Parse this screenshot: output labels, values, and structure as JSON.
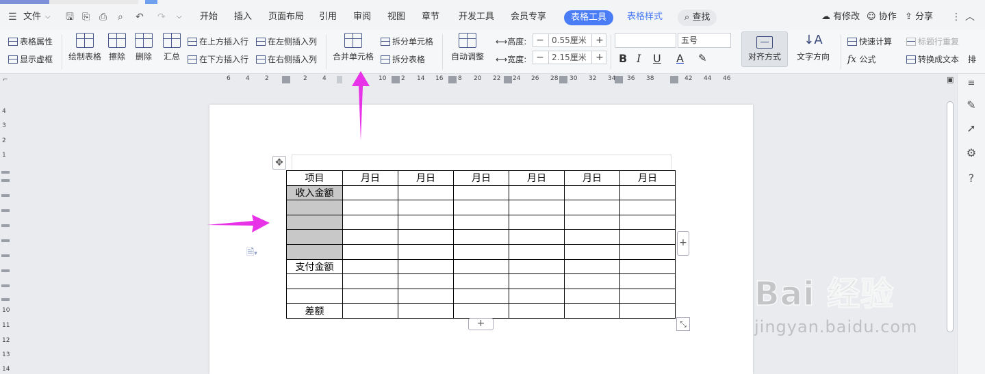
{
  "menubar": {
    "file": "文件",
    "tabs": [
      "开始",
      "插入",
      "页面布局",
      "引用",
      "审阅",
      "视图",
      "章节",
      "开发工具",
      "会员专享"
    ],
    "active_tab": "表格工具",
    "table_style_tab": "表格样式",
    "search": "查找",
    "modified": "有修改",
    "collab": "协作",
    "share": "分享"
  },
  "ribbon": {
    "table_props": "表格属性",
    "show_grid": "显示虚框",
    "draw_table": "绘制表格",
    "erase": "擦除",
    "delete": "删除",
    "summary": "汇总",
    "insert_row_above": "在上方插入行",
    "insert_row_below": "在下方插入行",
    "insert_col_left": "在左侧插入列",
    "insert_col_right": "在右侧插入列",
    "merge_cells": "合并单元格",
    "split_cells": "拆分单元格",
    "split_table": "拆分表格",
    "auto_fit": "自动调整",
    "height_label": "高度:",
    "height_value": "0.55厘米",
    "width_label": "宽度:",
    "width_value": "2.15厘米",
    "font_size": "五号",
    "bold": "B",
    "italic": "I",
    "underline": "U",
    "font_color": "A",
    "align": "对齐方式",
    "text_dir": "文字方向",
    "quick_calc": "快速计算",
    "repeat_header": "标题行重复",
    "formula": "公式",
    "convert_text": "转换成文本",
    "more": "排"
  },
  "ruler": {
    "h_labels": [
      "6",
      "4",
      "2",
      "2",
      "4",
      "10",
      "2",
      "14",
      "16",
      "8",
      "20",
      "22",
      "24",
      "26",
      "28",
      "30",
      "32",
      "34",
      "36",
      "38",
      "42",
      "44",
      "46"
    ],
    "v_labels": [
      "4",
      "3",
      "2",
      "1",
      "10",
      "11",
      "12",
      "13",
      "14"
    ]
  },
  "table": {
    "header": [
      "项目",
      "月日",
      "月日",
      "月日",
      "月日",
      "月日",
      "月日"
    ],
    "rows": [
      [
        "收入金额",
        "",
        "",
        "",
        "",
        "",
        ""
      ],
      [
        "",
        "",
        "",
        "",
        "",
        "",
        ""
      ],
      [
        "",
        "",
        "",
        "",
        "",
        "",
        ""
      ],
      [
        "",
        "",
        "",
        "",
        "",
        "",
        ""
      ],
      [
        "",
        "",
        "",
        "",
        "",
        "",
        ""
      ],
      [
        "支付金额",
        "",
        "",
        "",
        "",
        "",
        ""
      ],
      [
        "",
        "",
        "",
        "",
        "",
        "",
        ""
      ],
      [
        "",
        "",
        "",
        "",
        "",
        "",
        ""
      ],
      [
        "差额",
        "",
        "",
        "",
        "",
        "",
        ""
      ]
    ]
  },
  "watermark": {
    "main": "Bai 经验",
    "sub": "jingyan.baidu.com"
  },
  "colors": {
    "accent": "#4a7cf6",
    "arrow": "#e832e8",
    "selected_cell": "#c8c8c8"
  }
}
